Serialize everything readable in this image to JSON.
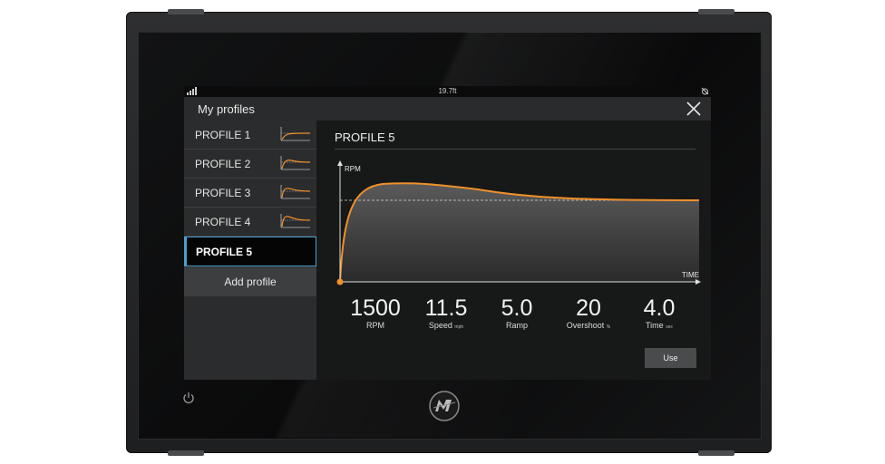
{
  "status": {
    "depth": "19.7ft"
  },
  "dialog": {
    "title": "My profiles"
  },
  "profiles": [
    {
      "label": "PROFILE 1",
      "selected": false
    },
    {
      "label": "PROFILE 2",
      "selected": false
    },
    {
      "label": "PROFILE 3",
      "selected": false
    },
    {
      "label": "PROFILE 4",
      "selected": false
    },
    {
      "label": "PROFILE 5",
      "selected": true
    }
  ],
  "add_profile_label": "Add profile",
  "detail": {
    "title": "PROFILE 5",
    "chart": {
      "ylabel": "RPM",
      "xlabel": "TIME"
    },
    "stats": [
      {
        "value": "1500",
        "label": "RPM",
        "unit": ""
      },
      {
        "value": "11.5",
        "label": "Speed",
        "unit": "mph"
      },
      {
        "value": "5.0",
        "label": "Ramp",
        "unit": ""
      },
      {
        "value": "20",
        "label": "Overshoot",
        "unit": "%"
      },
      {
        "value": "4.0",
        "label": "Time",
        "unit": "sec"
      }
    ],
    "use_label": "Use"
  },
  "colors": {
    "accent": "#f0902a",
    "selection": "#4aa0d0"
  },
  "icons": {
    "power": "power-icon",
    "logo": "mercury-logo-icon",
    "close": "close-icon"
  }
}
